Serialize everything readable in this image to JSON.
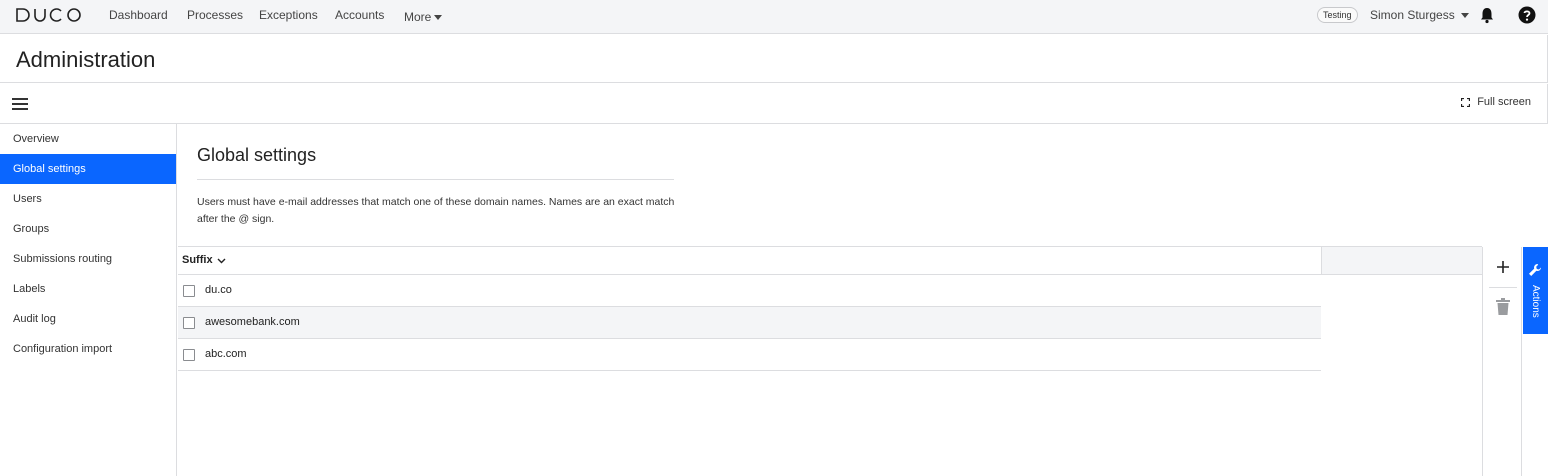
{
  "topbar": {
    "logo_text": "DUCO",
    "nav": [
      "Dashboard",
      "Processes",
      "Exceptions",
      "Accounts"
    ],
    "more_label": "More",
    "env_badge": "Testing",
    "user_name": "Simon Sturgess"
  },
  "page": {
    "title": "Administration",
    "fullscreen_label": "Full screen"
  },
  "sidebar": {
    "items": [
      {
        "label": "Overview"
      },
      {
        "label": "Global settings"
      },
      {
        "label": "Users"
      },
      {
        "label": "Groups"
      },
      {
        "label": "Submissions routing"
      },
      {
        "label": "Labels"
      },
      {
        "label": "Audit log"
      },
      {
        "label": "Configuration import"
      }
    ],
    "active_item": "Global settings"
  },
  "main": {
    "section_title": "Global settings",
    "description": "Users must have e-mail addresses that match one of these domain names. Names are an exact match after the @ sign.",
    "table": {
      "columns": [
        "Suffix"
      ],
      "sort": "descending",
      "rows": [
        {
          "suffix": "du.co",
          "checked": false
        },
        {
          "suffix": "awesomebank.com",
          "checked": false
        },
        {
          "suffix": "abc.com",
          "checked": false
        }
      ]
    }
  },
  "actions": {
    "tab_label": "Actions",
    "add_icon": "plus-icon",
    "delete_icon": "trash-icon"
  },
  "colors": {
    "accent": "#0a66ff",
    "topbar_bg": "#f4f5f7",
    "border": "#dcdde0"
  }
}
